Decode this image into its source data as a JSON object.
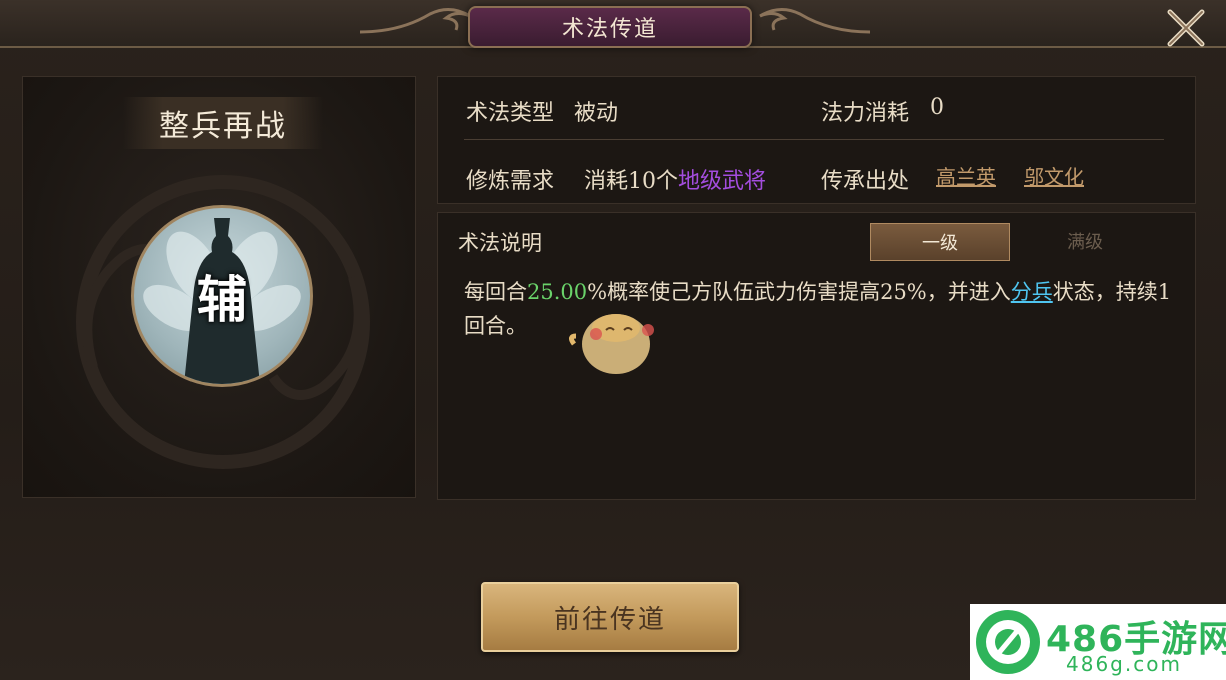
{
  "window": {
    "title": "术法传道"
  },
  "skill": {
    "name": "整兵再战",
    "icon_char": "辅"
  },
  "info": {
    "type_label": "术法类型",
    "type_value": "被动",
    "mana_label": "法力消耗",
    "mana_value": "0",
    "require_label": "修炼需求",
    "require_prefix": "消耗10个",
    "require_highlight": "地级武将",
    "source_label": "传承出处",
    "source_links": [
      "高兰英",
      "邬文化"
    ]
  },
  "description": {
    "title": "术法说明",
    "tabs": [
      {
        "label": "一级",
        "active": true
      },
      {
        "label": "满级",
        "active": false
      }
    ],
    "text_1": "每回合",
    "text_chance": "25.00",
    "text_2": "%概率使己方队伍武力伤害提高25%，并进入",
    "text_status": "分兵",
    "text_3": "状态，持续1回合。"
  },
  "buttons": {
    "go": "前往传道"
  },
  "watermark": {
    "main": "486手游网",
    "sub": "486g.com"
  },
  "icons": {
    "close": "close-x-icon",
    "mascot": "bird-mascot-icon"
  },
  "colors": {
    "highlight_purple": "#a34dde",
    "highlight_green": "#6ad36a",
    "status_blue": "#4fc5f0",
    "link_gold": "#c29a6b",
    "watermark_green": "#2fb45a"
  }
}
